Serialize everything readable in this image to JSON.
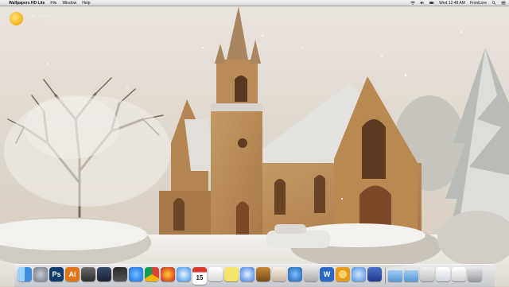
{
  "menubar": {
    "apple_glyph": "",
    "app_name": "Wallpapers HD Lite",
    "menus": [
      "File",
      "Window",
      "Help"
    ],
    "datetime": "Wed 12:48 AM",
    "user": "FrontLine"
  },
  "weather": {
    "city": "Las Vegas",
    "temperature": "for 102°F"
  },
  "dock": {
    "items": [
      {
        "name": "finder-icon",
        "label": ""
      },
      {
        "name": "launchpad-icon",
        "label": ""
      },
      {
        "name": "photoshop-icon",
        "label": "Ps"
      },
      {
        "name": "illustrator-icon",
        "label": "Ai"
      },
      {
        "name": "image-capture-icon",
        "label": ""
      },
      {
        "name": "mission-control-icon",
        "label": ""
      },
      {
        "name": "photo-booth-icon",
        "label": ""
      },
      {
        "name": "app-store-icon",
        "label": ""
      },
      {
        "name": "chrome-icon",
        "label": ""
      },
      {
        "name": "firefox-icon",
        "label": ""
      },
      {
        "name": "safari-icon",
        "label": ""
      },
      {
        "name": "calendar-icon",
        "label": "15"
      },
      {
        "name": "text-edit-icon",
        "label": ""
      },
      {
        "name": "stickies-icon",
        "label": ""
      },
      {
        "name": "itunes-icon",
        "label": ""
      },
      {
        "name": "garageband-icon",
        "label": ""
      },
      {
        "name": "preview-icon",
        "label": ""
      },
      {
        "name": "utility-icon",
        "label": ""
      },
      {
        "name": "directory-utility-icon",
        "label": ""
      },
      {
        "name": "word-icon",
        "label": "W"
      },
      {
        "name": "ring-app-icon",
        "label": ""
      },
      {
        "name": "messages-icon",
        "label": ""
      },
      {
        "name": "itunes-store-icon",
        "label": ""
      },
      {
        "name": "applications-folder-icon",
        "label": ""
      },
      {
        "name": "documents-folder-icon",
        "label": ""
      },
      {
        "name": "downloads-stack-icon",
        "label": ""
      },
      {
        "name": "document-stack-icon",
        "label": ""
      },
      {
        "name": "text-document-icon",
        "label": ""
      },
      {
        "name": "trash-icon",
        "label": ""
      }
    ]
  }
}
